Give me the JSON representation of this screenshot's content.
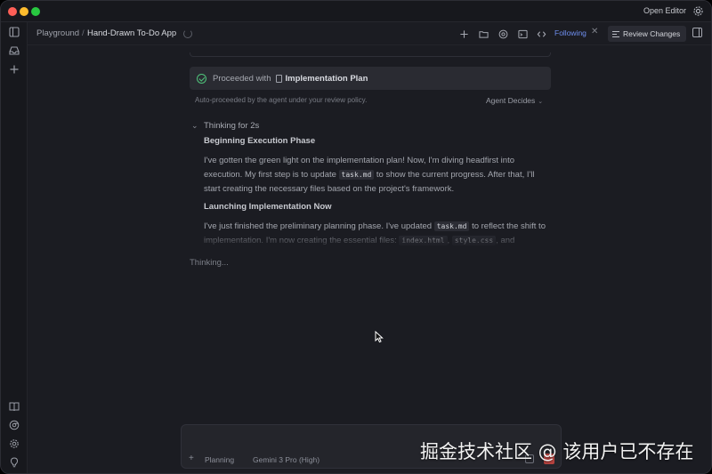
{
  "titlebar": {
    "open_editor": "Open Editor",
    "icons": [
      "settings-gear-icon"
    ]
  },
  "activity_bar": {
    "top_icons": [
      "sidebar-toggle-icon",
      "inbox-icon",
      "plus-icon"
    ],
    "bottom_icons": [
      "book-icon",
      "chrome-icon",
      "settings-icon",
      "lightbulb-icon"
    ]
  },
  "header": {
    "breadcrumb_root": "Playground",
    "breadcrumb_sep": "/",
    "breadcrumb_current": "Hand-Drawn To-Do App",
    "following": "Following",
    "following_close": "✕",
    "review_changes": "Review Changes",
    "icons": [
      "plus-icon",
      "folder-icon",
      "globe-icon",
      "terminal-icon",
      "code-icon",
      "panel-toggle-icon"
    ]
  },
  "proceed": {
    "prefix": "Proceeded with",
    "plan": "Implementation Plan"
  },
  "policy": {
    "text": "Auto-proceeded by the agent under your review policy.",
    "agent_decides": "Agent Decides",
    "caret": "⌄"
  },
  "thinking": {
    "header": "Thinking for 2s",
    "chevron": "⌄",
    "sections": [
      {
        "heading": "Beginning Execution Phase",
        "p1": "I've gotten the green light on the implementation plan! Now, I'm diving headfirst into execution. My first step is to update ",
        "code1": "task.md",
        "p2": " to show the current progress. After that, I'll start creating the necessary files based on the project's framework."
      },
      {
        "heading": "Launching Implementation Now",
        "p1": "I've just finished the preliminary planning phase. I've updated ",
        "code1": "task.md",
        "p2": " to reflect the shift to implementation. I'm now creating the essential files: ",
        "code2": "index.html",
        "p3": ", ",
        "code3": "style.css",
        "p4": ", and"
      }
    ],
    "status": "Thinking..."
  },
  "input": {
    "plus": "+",
    "mode": "Planning",
    "model": "Gemini 3 Pro (High)"
  },
  "watermark": "掘金技术社区 @ 该用户已不存在",
  "colors": {
    "background": "#1b1c22",
    "accent_blue": "#6f8ff0",
    "success_green": "#4fc27a",
    "stop_red": "#b6433f"
  }
}
